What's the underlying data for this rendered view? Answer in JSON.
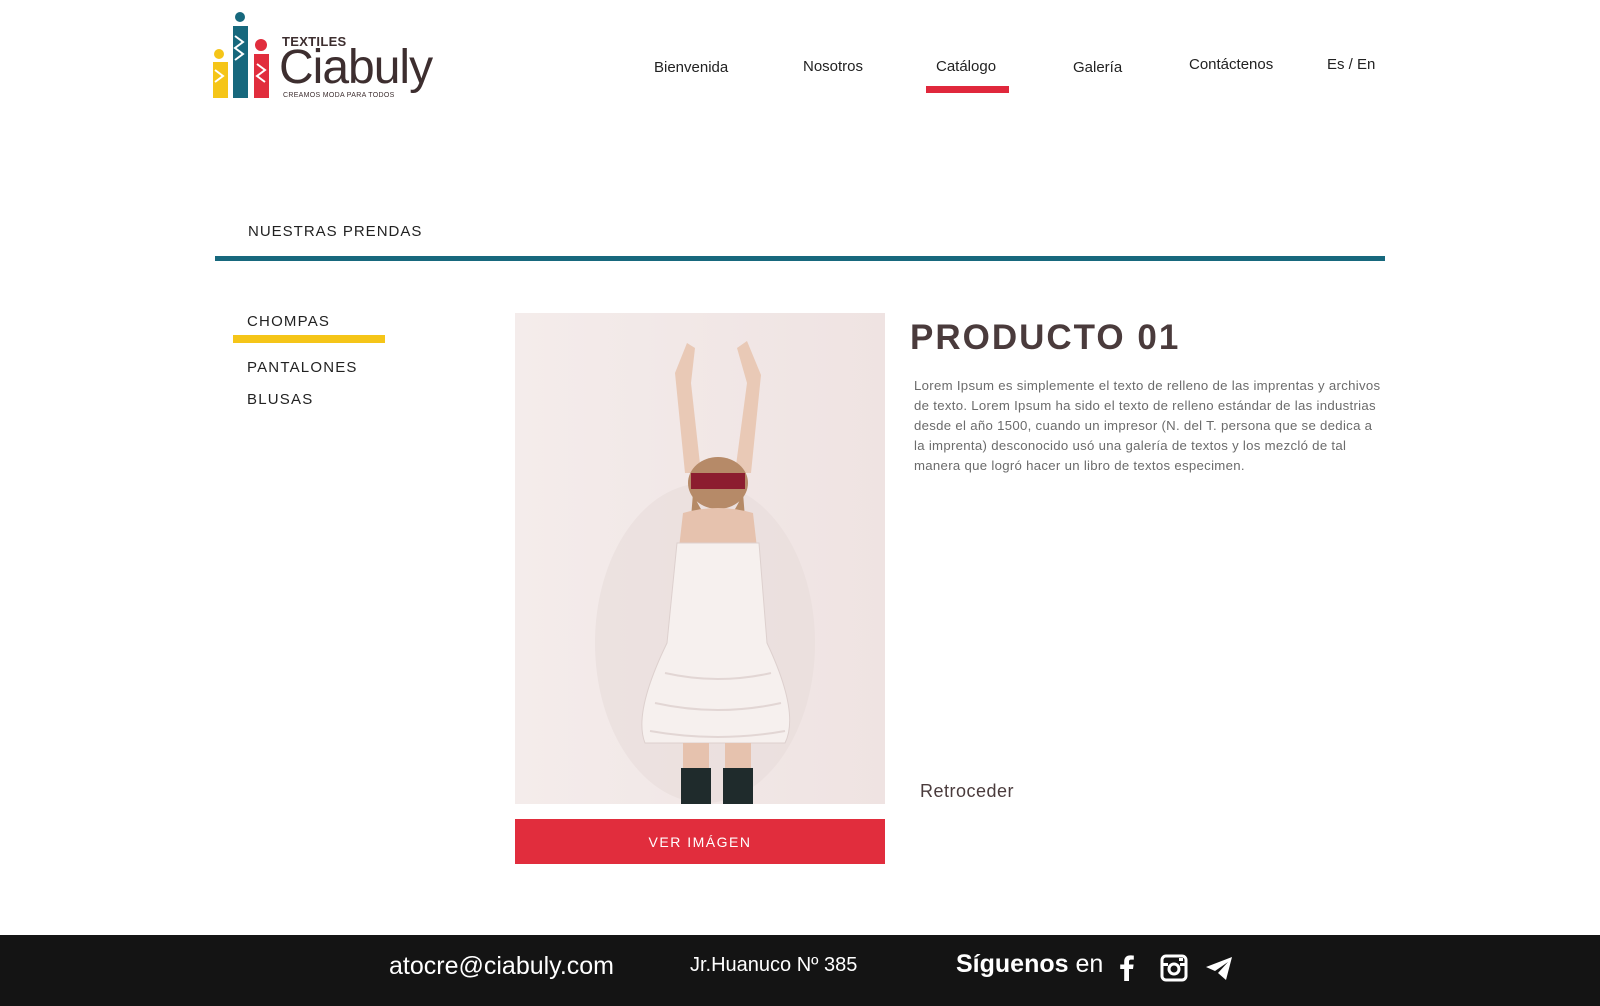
{
  "brand": {
    "textiles": "TEXTILES",
    "name": "Ciabuly",
    "tagline": "CREAMOS MODA PARA TODOS"
  },
  "nav": {
    "items": [
      {
        "label": "Bienvenida"
      },
      {
        "label": "Nosotros"
      },
      {
        "label": "Catálogo",
        "active": true
      },
      {
        "label": "Galería"
      },
      {
        "label": "Contáctenos"
      }
    ],
    "language": "Es / En"
  },
  "section": {
    "title": "NUESTRAS PRENDAS"
  },
  "categories": [
    {
      "label": "CHOMPAS",
      "active": true
    },
    {
      "label": "PANTALONES"
    },
    {
      "label": "BLUSAS"
    }
  ],
  "product": {
    "title": "PRODUCTO 01",
    "description": "Lorem Ipsum es simplemente el texto de relleno de las imprentas y archivos de texto. Lorem Ipsum ha sido el texto de relleno estándar de las industrias desde el año 1500, cuando un impresor (N. del T. persona que se dedica a la imprenta) desconocido usó una galería de textos y los mezcló de tal manera que logró hacer un libro de textos especimen.",
    "view_button": "VER IMÁGEN",
    "back_link": "Retroceder"
  },
  "footer": {
    "email": "atocre@ciabuly.com",
    "address": "Jr.Huanuco Nº 385",
    "follow_bold": "Síguenos",
    "follow_rest": " en",
    "social_icons": [
      "facebook-icon",
      "instagram-icon",
      "telegram-icon"
    ]
  },
  "colors": {
    "accent_red": "#e12d3d",
    "teal": "#17687d",
    "yellow": "#f5c518",
    "footer_bg": "#141414",
    "title_brown": "#4a3b3c"
  }
}
